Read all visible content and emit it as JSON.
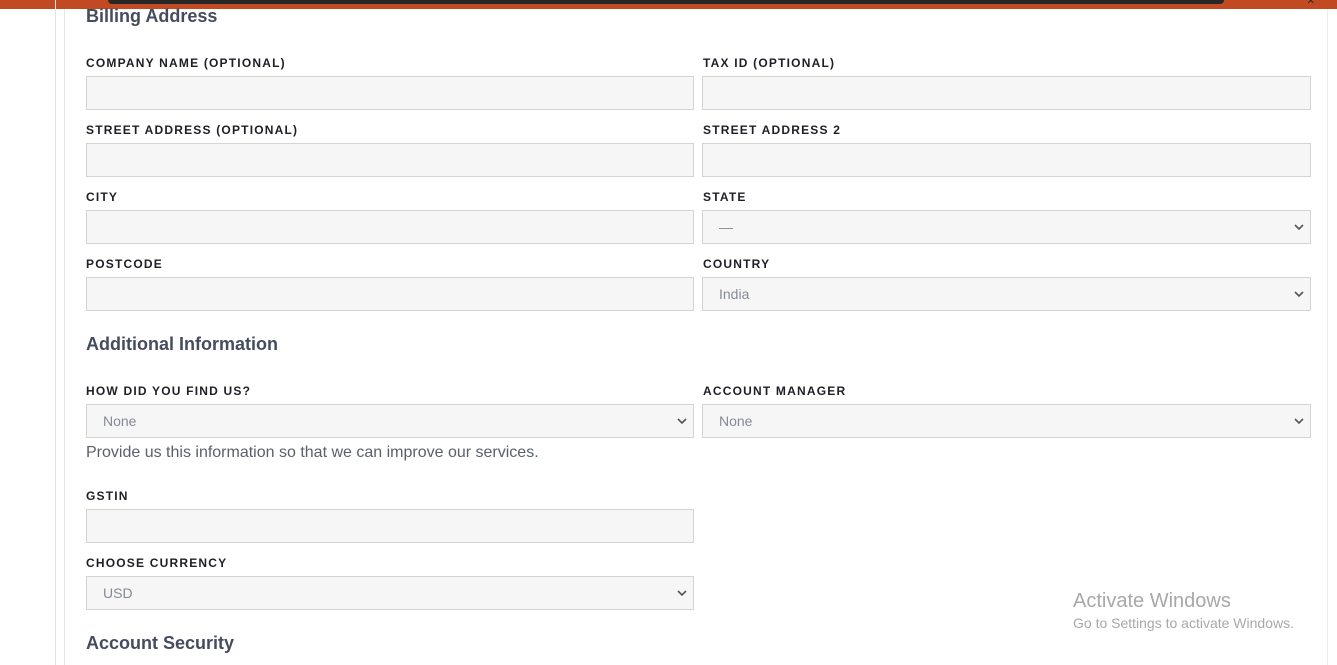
{
  "billing": {
    "heading": "Billing Address",
    "company_label": "COMPANY NAME (OPTIONAL)",
    "company_value": "",
    "taxid_label": "TAX ID (OPTIONAL)",
    "taxid_value": "",
    "street_label": "STREET ADDRESS (OPTIONAL)",
    "street_value": "",
    "street2_label": "STREET ADDRESS 2",
    "street2_value": "",
    "city_label": "CITY",
    "city_value": "",
    "state_label": "STATE",
    "state_value": "—",
    "postcode_label": "POSTCODE",
    "postcode_value": "",
    "country_label": "COUNTRY",
    "country_value": "India"
  },
  "additional": {
    "heading": "Additional Information",
    "findus_label": "HOW DID YOU FIND US?",
    "findus_value": "None",
    "findus_help": "Provide us this information so that we can improve our services.",
    "manager_label": "ACCOUNT MANAGER",
    "manager_value": "None",
    "gstin_label": "GSTIN",
    "gstin_value": "",
    "currency_label": "CHOOSE CURRENCY",
    "currency_value": "USD"
  },
  "security": {
    "heading": "Account Security"
  },
  "watermark": {
    "title": "Activate Windows",
    "subtitle": "Go to Settings to activate Windows."
  },
  "icons": {
    "select_arrow": "chevron-down-icon",
    "window_close": "close-icon"
  },
  "colors": {
    "accent_bar": "#c14a22",
    "field_bg": "#f6f6f6",
    "field_border": "#d4d4d4"
  }
}
